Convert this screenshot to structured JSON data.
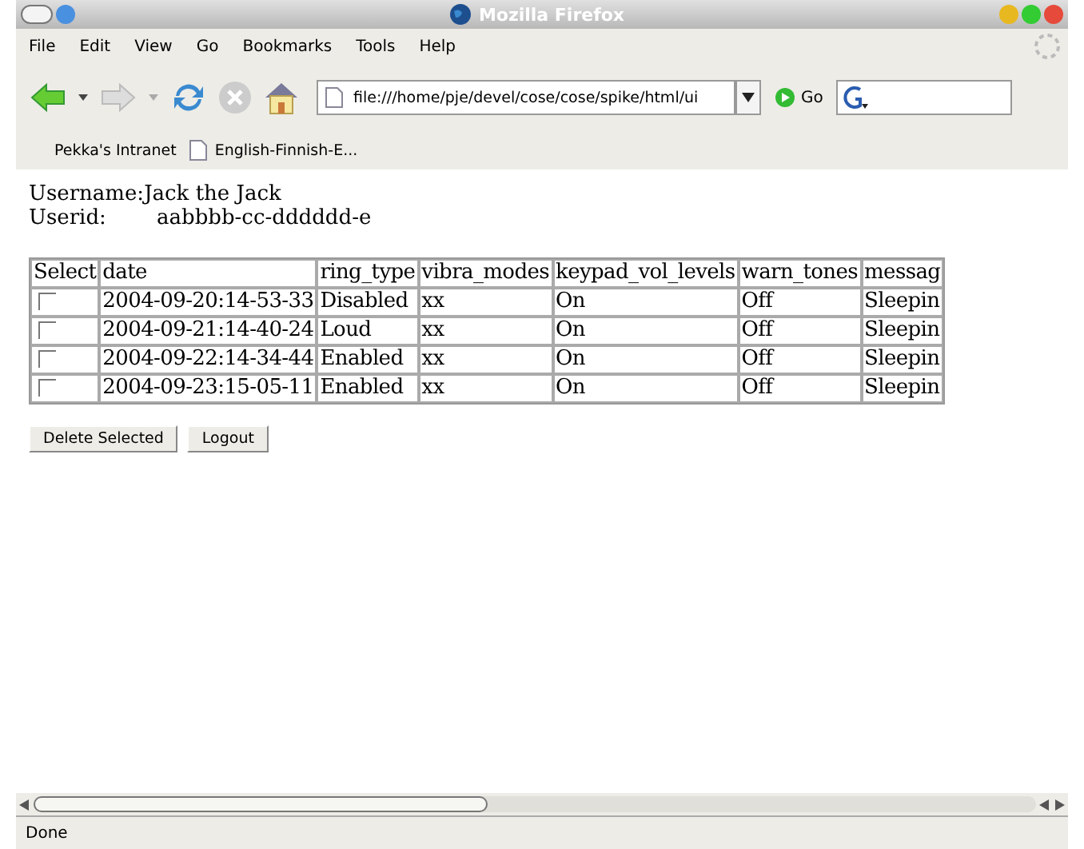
{
  "window": {
    "title": "Mozilla Firefox"
  },
  "menu": [
    "File",
    "Edit",
    "View",
    "Go",
    "Bookmarks",
    "Tools",
    "Help"
  ],
  "toolbar": {
    "address": "file:///home/pje/devel/cose/cose/spike/html/ui",
    "go": "Go"
  },
  "bookmarks": [
    {
      "label": "Pekka's Intranet",
      "kind": "folder"
    },
    {
      "label": "English-Finnish-E...",
      "kind": "page"
    }
  ],
  "user": {
    "username_label": "Username:",
    "username": "Jack the Jack",
    "userid_label": "Userid:",
    "userid": "aabbbb-cc-dddddd-e"
  },
  "table": {
    "select_header": "Select",
    "columns": [
      "date",
      "ring_type",
      "vibra_modes",
      "keypad_vol_levels",
      "warn_tones",
      "messag"
    ],
    "rows": [
      {
        "checked": false,
        "cells": [
          "2004-09-20:14-53-33",
          "Disabled",
          "xx",
          "On",
          "Off",
          "Sleepin"
        ]
      },
      {
        "checked": false,
        "cells": [
          "2004-09-21:14-40-24",
          "Loud",
          "xx",
          "On",
          "Off",
          "Sleepin"
        ]
      },
      {
        "checked": false,
        "cells": [
          "2004-09-22:14-34-44",
          "Enabled",
          "xx",
          "On",
          "Off",
          "Sleepin"
        ]
      },
      {
        "checked": false,
        "cells": [
          "2004-09-23:15-05-11",
          "Enabled",
          "xx",
          "On",
          "Off",
          "Sleepin"
        ]
      }
    ]
  },
  "buttons": [
    "Delete Selected",
    "Logout"
  ],
  "status_bar": "Done"
}
